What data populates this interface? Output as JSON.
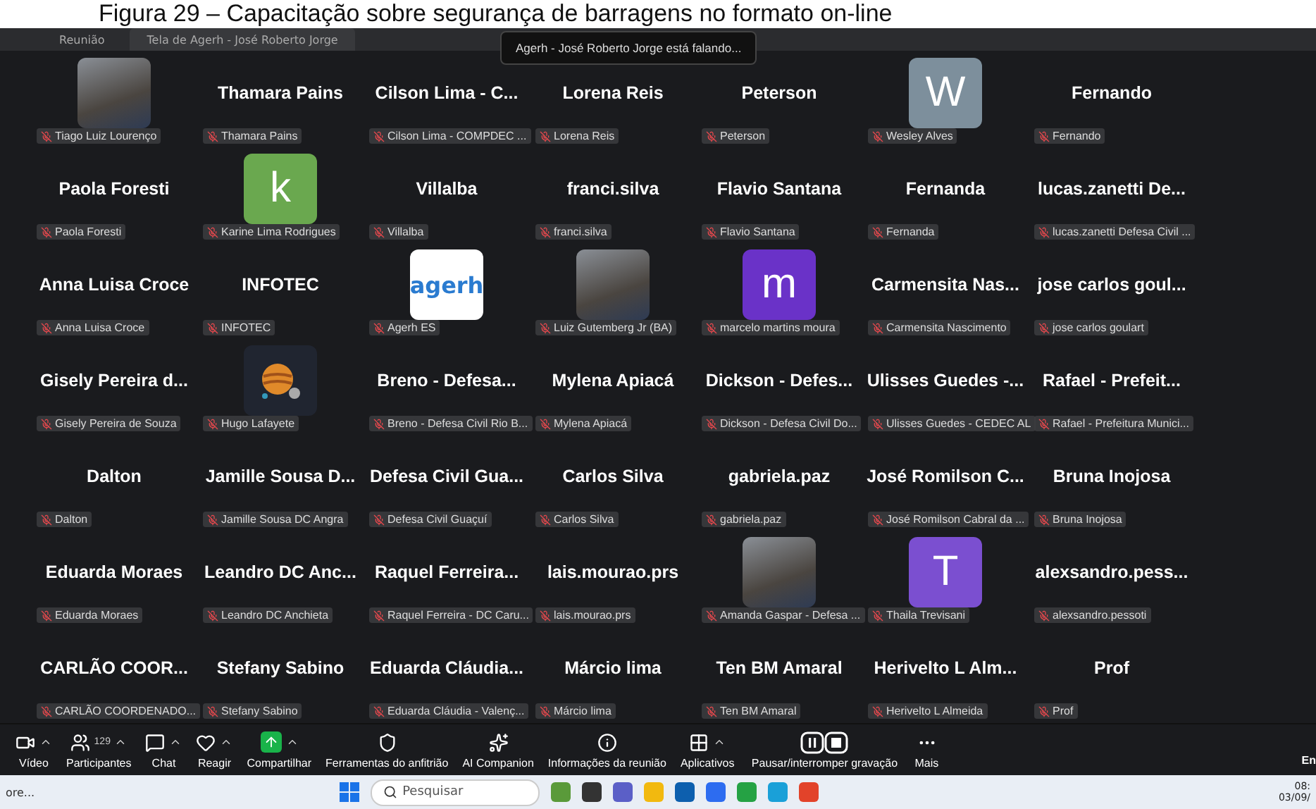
{
  "caption": "Figura 29 – Capacitação sobre segurança de barragens no formato on-line",
  "top_bar": {
    "tabs": [
      {
        "label": "Reunião",
        "selected": false
      },
      {
        "label": "Tela de Agerh - José Roberto Jorge",
        "selected": true
      }
    ]
  },
  "speaking_banner": "Agerh - José Roberto Jorge está falando...",
  "tiles": [
    {
      "kind": "photo",
      "label": "Tiago Luiz Lourenço",
      "muted": true
    },
    {
      "kind": "name",
      "name": "Thamara Pains",
      "label": "Thamara Pains",
      "muted": true
    },
    {
      "kind": "name",
      "name": "Cilson Lima - C...",
      "label": "Cilson Lima - COMPDEC ...",
      "muted": true
    },
    {
      "kind": "name",
      "name": "Lorena Reis",
      "label": "Lorena Reis",
      "muted": true
    },
    {
      "kind": "name",
      "name": "Peterson",
      "label": "Peterson",
      "muted": true
    },
    {
      "kind": "letter",
      "letter": "W",
      "color": "#7d8f9c",
      "label": "Wesley Alves",
      "muted": true
    },
    {
      "kind": "name",
      "name": "Fernando",
      "label": "Fernando",
      "muted": true
    },
    {
      "kind": "name",
      "name": "Paola Foresti",
      "label": "Paola Foresti",
      "muted": true
    },
    {
      "kind": "letter",
      "letter": "k",
      "color": "#6aa84f",
      "label": "Karine Lima Rodrigues",
      "muted": true
    },
    {
      "kind": "name",
      "name": "Villalba",
      "label": "Villalba",
      "muted": true
    },
    {
      "kind": "name",
      "name": "franci.silva",
      "label": "franci.silva",
      "muted": true
    },
    {
      "kind": "name",
      "name": "Flavio Santana",
      "label": "Flavio Santana",
      "muted": true
    },
    {
      "kind": "name",
      "name": "Fernanda",
      "label": "Fernanda",
      "muted": true
    },
    {
      "kind": "name",
      "name": "lucas.zanetti De...",
      "label": "lucas.zanetti Defesa Civil ...",
      "muted": true
    },
    {
      "kind": "name",
      "name": "Anna Luisa Croce",
      "label": "Anna Luisa Croce",
      "muted": true
    },
    {
      "kind": "name",
      "name": "INFOTEC",
      "label": "INFOTEC",
      "muted": true
    },
    {
      "kind": "logo",
      "logo_text": "agerh",
      "label": "Agerh ES",
      "muted": true
    },
    {
      "kind": "photo",
      "label": "Luiz Gutemberg Jr (BA)",
      "muted": true
    },
    {
      "kind": "letter",
      "letter": "m",
      "color": "#6a32c8",
      "label": "marcelo martins moura",
      "muted": true
    },
    {
      "kind": "name",
      "name": "Carmensita Nas...",
      "label": "Carmensita Nascimento",
      "muted": true
    },
    {
      "kind": "name",
      "name": "jose carlos goul...",
      "label": "jose carlos goulart",
      "muted": true
    },
    {
      "kind": "name",
      "name": "Gisely Pereira d...",
      "label": "Gisely Pereira de Souza",
      "muted": true
    },
    {
      "kind": "planet",
      "label": "Hugo Lafayete",
      "muted": true
    },
    {
      "kind": "name",
      "name": "Breno - Defesa...",
      "label": "Breno - Defesa Civil Rio B...",
      "muted": true
    },
    {
      "kind": "name",
      "name": "Mylena Apiacá",
      "label": "Mylena Apiacá",
      "muted": true
    },
    {
      "kind": "name",
      "name": "Dickson - Defes...",
      "label": "Dickson - Defesa Civil Do...",
      "muted": true
    },
    {
      "kind": "name",
      "name": "Ulisses Guedes -...",
      "label": "Ulisses Guedes - CEDEC AL",
      "muted": true
    },
    {
      "kind": "name",
      "name": "Rafael - Prefeit...",
      "label": "Rafael - Prefeitura Munici...",
      "muted": true
    },
    {
      "kind": "name",
      "name": "Dalton",
      "label": "Dalton",
      "muted": true
    },
    {
      "kind": "name",
      "name": "Jamille Sousa D...",
      "label": "Jamille Sousa DC Angra",
      "muted": true
    },
    {
      "kind": "name",
      "name": "Defesa Civil Gua...",
      "label": "Defesa Civil Guaçuí",
      "muted": true
    },
    {
      "kind": "name",
      "name": "Carlos Silva",
      "label": "Carlos Silva",
      "muted": true
    },
    {
      "kind": "name",
      "name": "gabriela.paz",
      "label": "gabriela.paz",
      "muted": true
    },
    {
      "kind": "name",
      "name": "José Romilson C...",
      "label": "José Romilson Cabral da ...",
      "muted": true
    },
    {
      "kind": "name",
      "name": "Bruna Inojosa",
      "label": "Bruna Inojosa",
      "muted": true
    },
    {
      "kind": "name",
      "name": "Eduarda Moraes",
      "label": "Eduarda Moraes",
      "muted": true
    },
    {
      "kind": "name",
      "name": "Leandro DC Anc...",
      "label": "Leandro DC Anchieta",
      "muted": true
    },
    {
      "kind": "name",
      "name": "Raquel Ferreira...",
      "label": "Raquel Ferreira - DC Caru...",
      "muted": true
    },
    {
      "kind": "name",
      "name": "lais.mourao.prs",
      "label": "lais.mourao.prs",
      "muted": true
    },
    {
      "kind": "photo",
      "label": "Amanda Gaspar - Defesa ...",
      "muted": true
    },
    {
      "kind": "letter",
      "letter": "T",
      "color": "#7b4fd0",
      "label": "Thaila Trevisani",
      "muted": true
    },
    {
      "kind": "name",
      "name": "alexsandro.pess...",
      "label": "alexsandro.pessoti",
      "muted": true
    },
    {
      "kind": "name",
      "name": "CARLÃO COOR...",
      "label": "CARLÃO COORDENADO...",
      "muted": true
    },
    {
      "kind": "name",
      "name": "Stefany Sabino",
      "label": "Stefany Sabino",
      "muted": true
    },
    {
      "kind": "name",
      "name": "Eduarda Cláudia...",
      "label": "Eduarda Cláudia - Valenç...",
      "muted": true
    },
    {
      "kind": "name",
      "name": "Márcio lima",
      "label": "Márcio lima",
      "muted": true
    },
    {
      "kind": "name",
      "name": "Ten BM Amaral",
      "label": "Ten BM Amaral",
      "muted": true
    },
    {
      "kind": "name",
      "name": "Herivelto L Alm...",
      "label": "Herivelto L Almeida",
      "muted": true
    },
    {
      "kind": "name",
      "name": "Prof",
      "label": "Prof",
      "muted": true
    }
  ],
  "toolbar": [
    {
      "label": "Vídeo",
      "menu": true
    },
    {
      "label": "Participantes",
      "count": "129",
      "menu": true
    },
    {
      "label": "Chat",
      "menu": true
    },
    {
      "label": "Reagir",
      "menu": true
    },
    {
      "label": "Compartilhar",
      "menu": true
    },
    {
      "label": "Ferramentas do anfitrião",
      "menu": false
    },
    {
      "label": "AI Companion",
      "menu": false
    },
    {
      "label": "Informações da reunião",
      "menu": false
    },
    {
      "label": "Aplicativos",
      "menu": true
    },
    {
      "label": "Pausar/interromper gravação",
      "menu": false
    },
    {
      "label": "Mais",
      "menu": false
    }
  ],
  "end_button": "En",
  "taskbar": {
    "left_text": "ore...",
    "search_placeholder": "Pesquisar",
    "time": "08:",
    "date": "03/09/"
  }
}
